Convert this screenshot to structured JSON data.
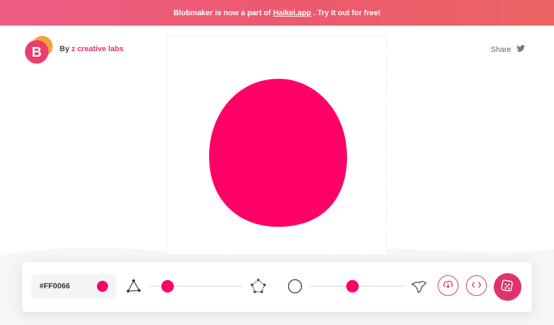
{
  "banner": {
    "prefix": "Blobmaker is now a part of",
    "link": "Haikei.app",
    "suffix": ". Try it out for free!"
  },
  "header": {
    "logo_letter": "B",
    "by": "By",
    "brand": "z creative labs",
    "share_label": "Share"
  },
  "blob": {
    "color": "#FF0066"
  },
  "toolbar": {
    "color_hex": "#FF0066",
    "complexity_level": 0.2,
    "contrast_level": 0.45
  },
  "colors": {
    "accent": "#e0336c",
    "banner_start": "#ee5c86",
    "banner_end": "#ea6563"
  },
  "icons": [
    "logo-icon",
    "twitter-icon",
    "triangle-icon",
    "pentagon-icon",
    "circle-icon",
    "spiky-blob-icon",
    "download-icon",
    "code-icon",
    "dice-icon"
  ]
}
